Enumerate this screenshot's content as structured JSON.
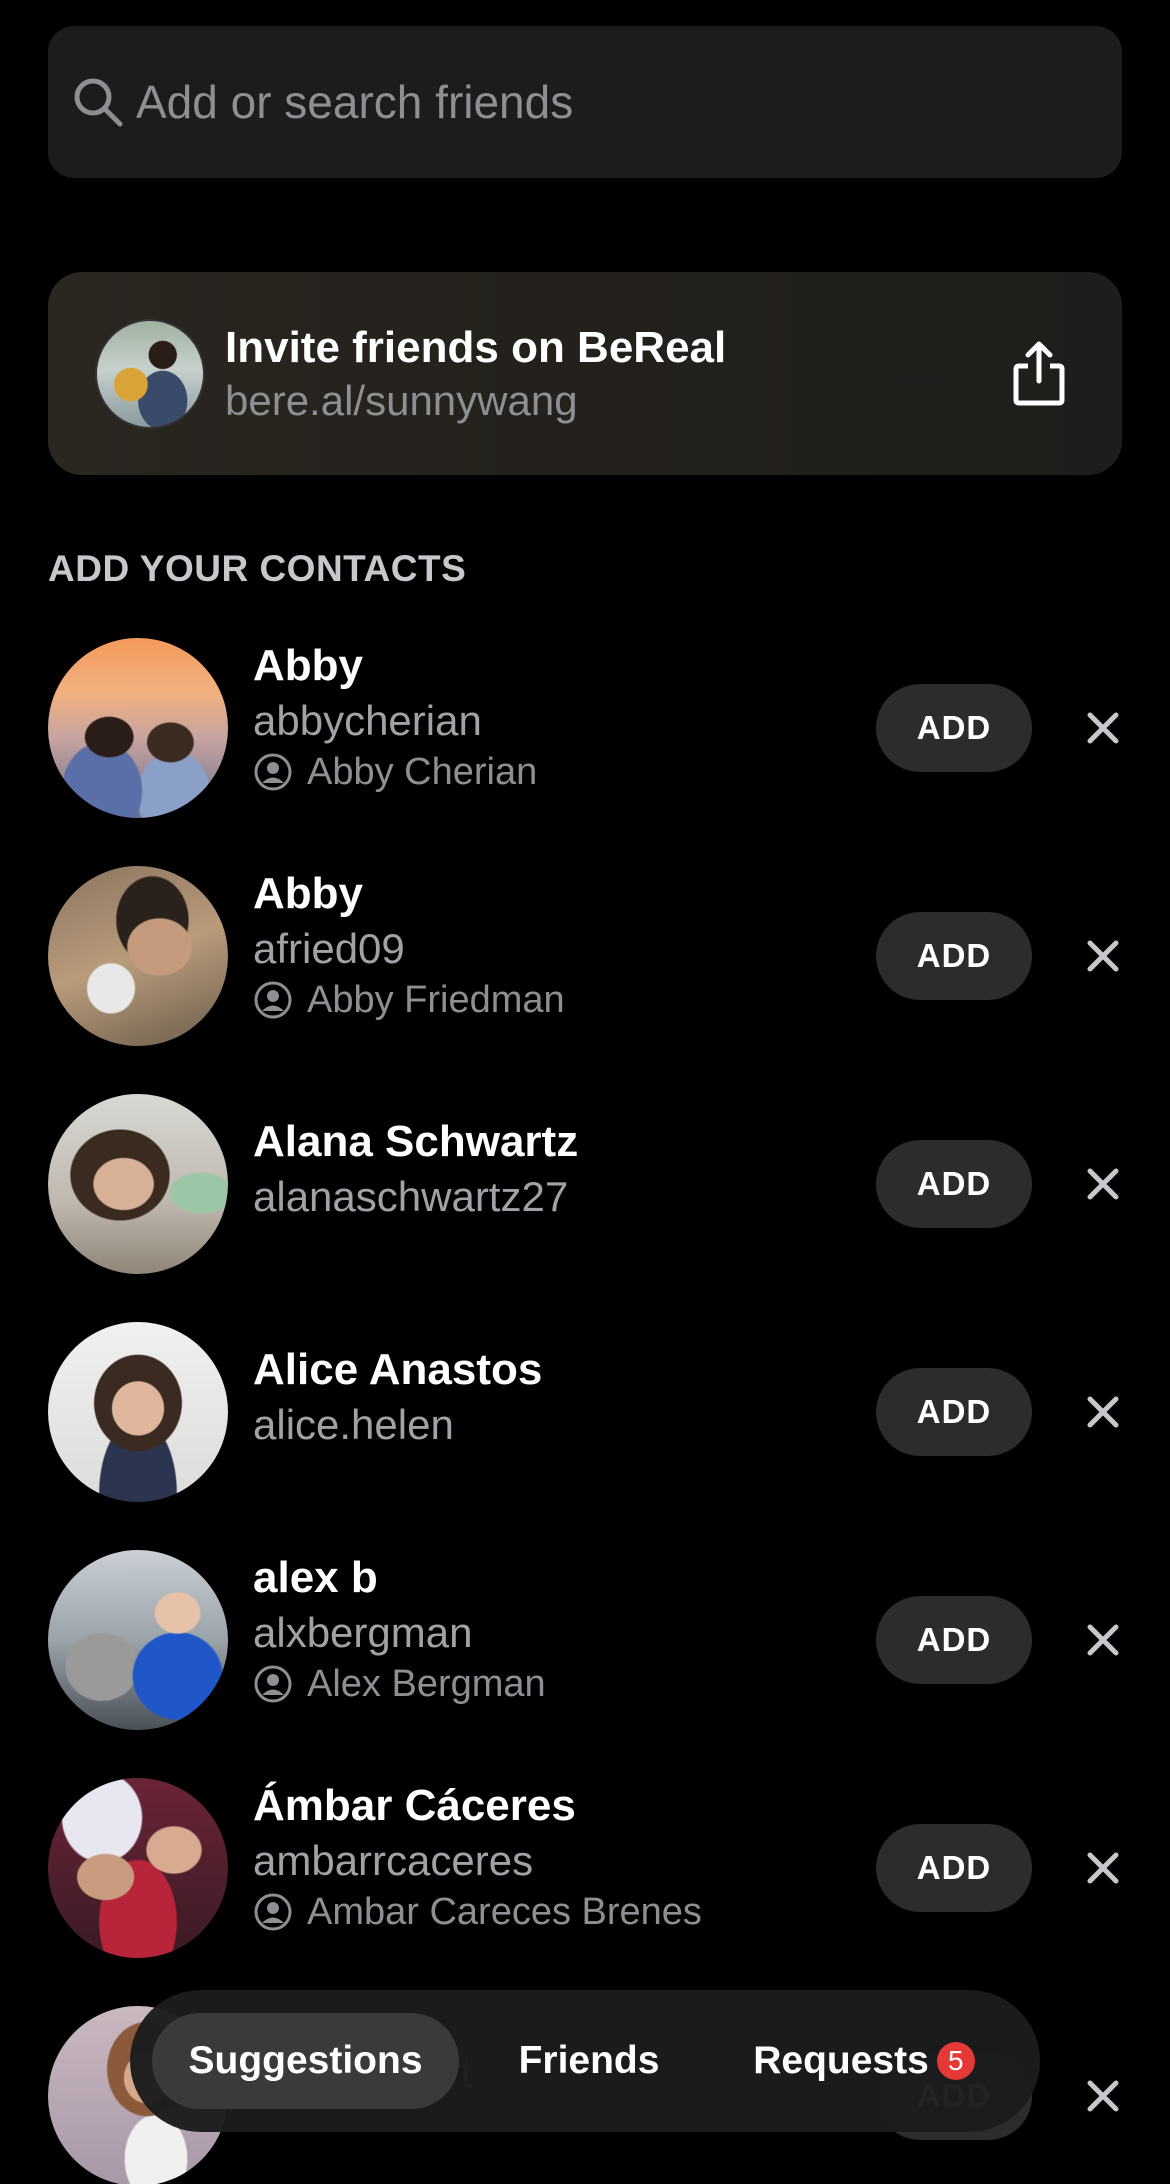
{
  "search": {
    "placeholder": "Add or search friends"
  },
  "invite": {
    "title": "Invite friends on BeReal",
    "link": "bere.al/sunnywang"
  },
  "section_title": "ADD YOUR CONTACTS",
  "add_label": "ADD",
  "contacts": [
    {
      "name": "Abby",
      "username": "abbycherian",
      "contact_name": "Abby Cherian"
    },
    {
      "name": "Abby",
      "username": "afried09",
      "contact_name": "Abby Friedman"
    },
    {
      "name": "Alana Schwartz",
      "username": "alanaschwartz27",
      "contact_name": ""
    },
    {
      "name": "Alice Anastos",
      "username": "alice.helen",
      "contact_name": ""
    },
    {
      "name": "alex b",
      "username": "alxbergman",
      "contact_name": "Alex Bergman"
    },
    {
      "name": "Ámbar Cáceres",
      "username": "ambarrcaceres",
      "contact_name": "Ambar Careces Brenes"
    },
    {
      "name": "",
      "username": "ameliagport",
      "contact_name": ""
    }
  ],
  "tabs": {
    "suggestions": "Suggestions",
    "friends": "Friends",
    "requests": "Requests",
    "requests_badge": "5"
  }
}
